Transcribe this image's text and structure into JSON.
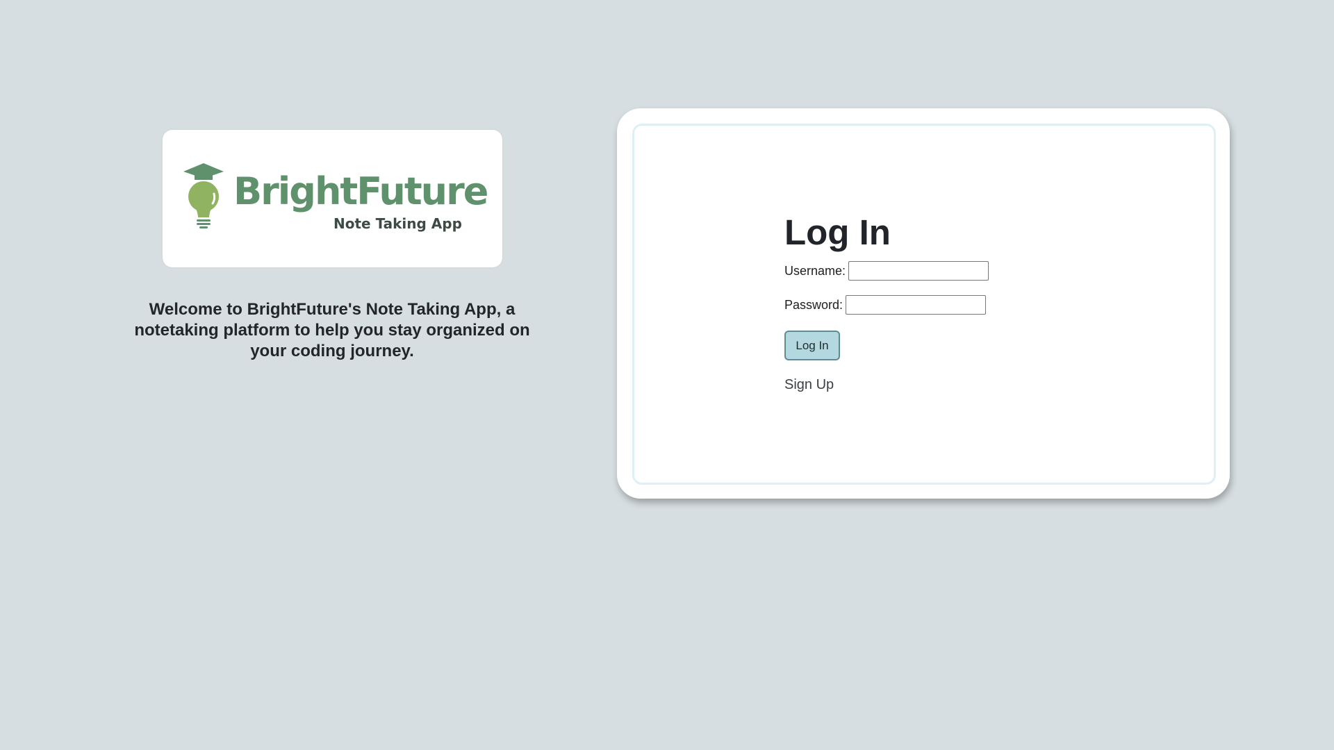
{
  "logo": {
    "wordmark": "BrightFuture",
    "subtitle": "Note Taking App",
    "icon": "lightbulb-graduation-cap-icon",
    "brand_color": "#5e916c",
    "bulb_color": "#8fb360"
  },
  "welcome": {
    "text": "Welcome to BrightFuture's Note Taking App, a notetaking platform to help you stay organized on your coding journey."
  },
  "login": {
    "title": "Log In",
    "username_label": "Username:",
    "username_value": "",
    "password_label": "Password:",
    "password_value": "",
    "submit_label": "Log In",
    "signup_label": "Sign Up"
  },
  "colors": {
    "background": "#d6dee1",
    "button_bg": "#b4d8df",
    "button_border": "#5f8d8f",
    "inner_border": "#dcf0f5"
  }
}
